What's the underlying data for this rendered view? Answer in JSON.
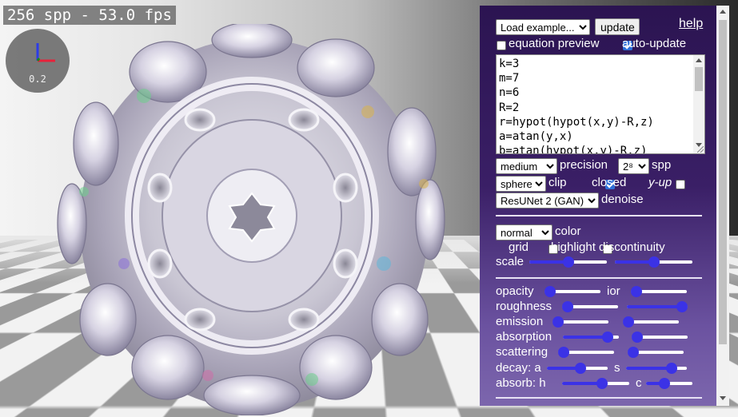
{
  "stats": {
    "text": "256 spp - 53.0 fps"
  },
  "gizmo": {
    "scale": "0.2",
    "axis_colors": {
      "x": "#e8213a",
      "y": "#2c3ce8",
      "z": "#1a8a1a"
    }
  },
  "panel": {
    "example_select": {
      "value": "Load example...",
      "options": [
        "Load example..."
      ]
    },
    "update_label": "update",
    "help_label": "help",
    "equation_preview": {
      "label": "equation preview",
      "checked": false
    },
    "auto_update": {
      "label": "auto-update",
      "checked": true
    },
    "code": "k=3\nm=7\nn=6\nR=2\nr=hypot(hypot(x,y)-R,z)\na=atan(y,x)\nb=atan(hypot(x,y)-R,z)",
    "precision": {
      "value": "medium",
      "label": "precision"
    },
    "spp": {
      "value": "2⁸",
      "label": "spp"
    },
    "clip": {
      "value": "sphere",
      "label": "clip"
    },
    "closed": {
      "label": "closed",
      "checked": true
    },
    "yup": {
      "label": "y-up",
      "checked": false
    },
    "denoise": {
      "value": "ResUNet 2 (GAN)",
      "label": "denoise"
    },
    "color": {
      "value": "normal",
      "label": "color"
    },
    "grid": {
      "label": "grid",
      "checked": false
    },
    "highlight": {
      "label": "highlight discontinuity",
      "checked": false
    },
    "scale": {
      "label": "scale",
      "left": 0.5,
      "right": 0.5
    },
    "opacity": {
      "label": "opacity",
      "value": 0.0
    },
    "ior": {
      "label": "ior",
      "value": 0.0
    },
    "roughness": {
      "label": "roughness",
      "left": 0.0,
      "right": 0.98
    },
    "emission": {
      "label": "emission",
      "left": 0.0,
      "right": 0.0
    },
    "absorption": {
      "label": "absorption",
      "left": 0.8,
      "right": 0.0
    },
    "scattering": {
      "label": "scattering",
      "left": 0.0,
      "right": 0.0
    },
    "decay": {
      "label": "decay: a",
      "s_label": "s",
      "left": 0.55,
      "right": 0.75
    },
    "absorb": {
      "label": "absorb: h",
      "c_label": "c",
      "left": 0.6,
      "right": 0.4
    }
  },
  "colors": {
    "accent": "#3b32e6",
    "panel_top": "#2b1451",
    "panel_bottom": "#7c66ad"
  }
}
